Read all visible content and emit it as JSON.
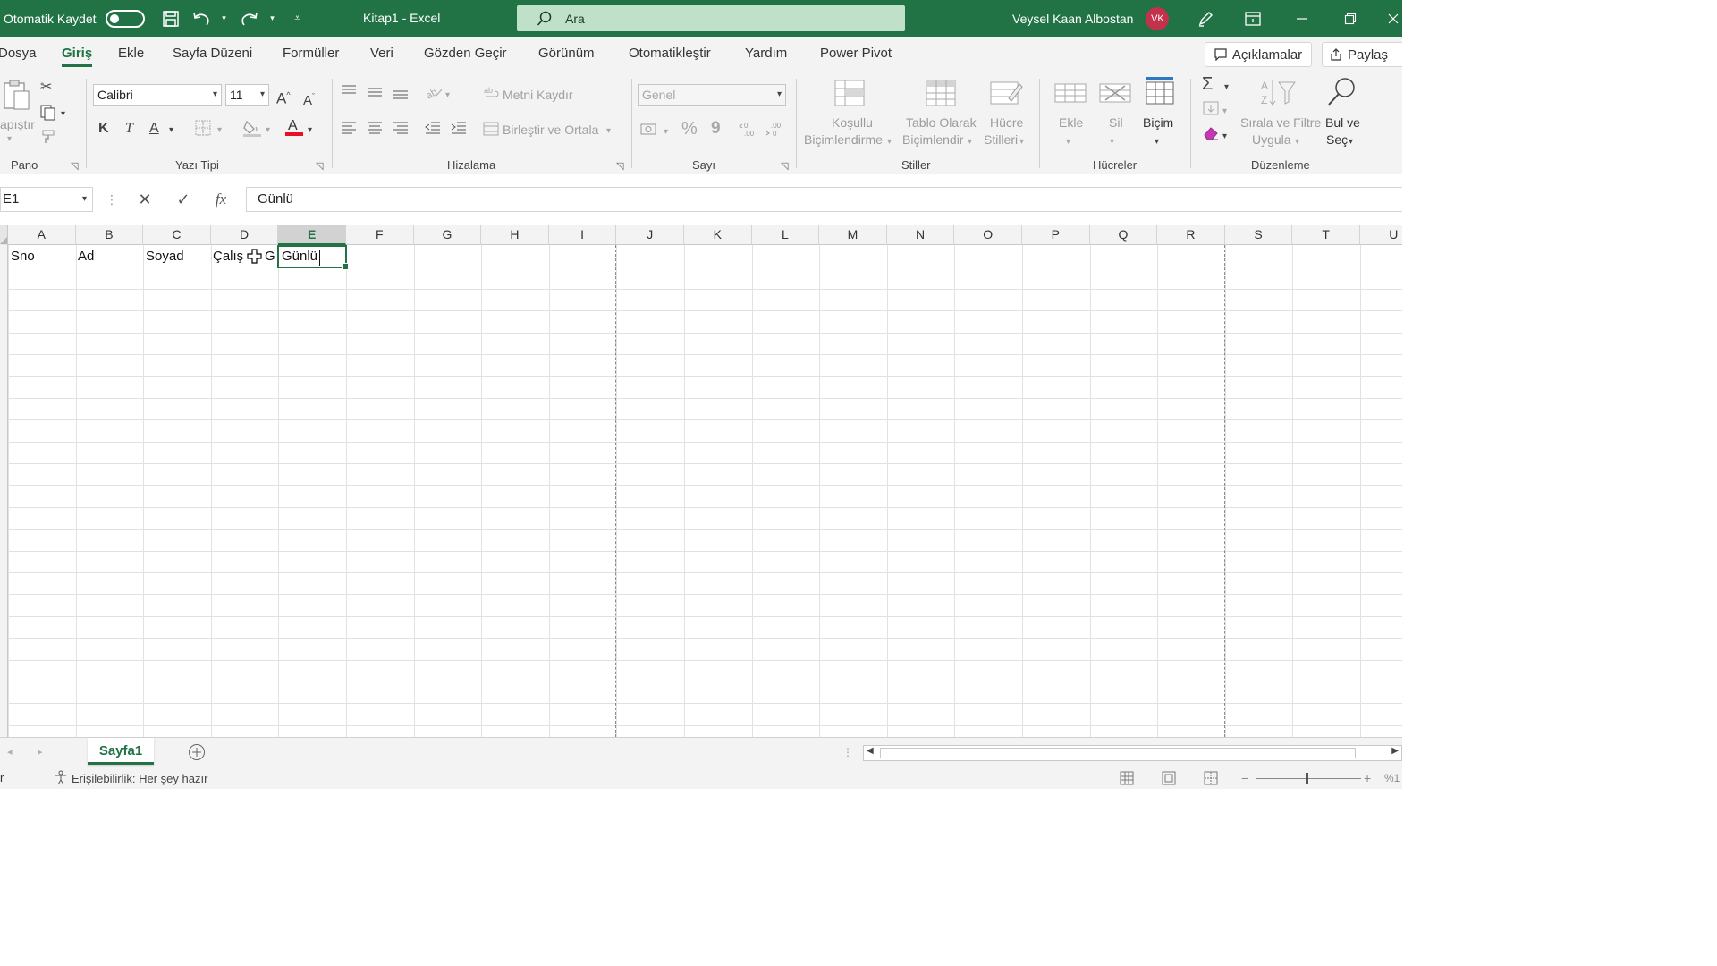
{
  "titlebar": {
    "autosave_label": "Otomatik Kaydet",
    "doc_title": "Kitap1 - Excel",
    "search_placeholder": "Ara",
    "user_name": "Veysel Kaan Albostan",
    "user_initials": "VK",
    "accent": "#217346"
  },
  "menu": {
    "tabs": [
      "Dosya",
      "Giriş",
      "Ekle",
      "Sayfa Düzeni",
      "Formüller",
      "Veri",
      "Gözden Geçir",
      "Görünüm",
      "Otomatikleştir",
      "Yardım",
      "Power Pivot"
    ],
    "active": "Giriş",
    "comments": "Açıklamalar",
    "share": "Paylaş"
  },
  "ribbon": {
    "pano": {
      "label": "Pano",
      "paste": "apıştır"
    },
    "font": {
      "label": "Yazı Tipi",
      "family": "Calibri",
      "size": "11",
      "bold": "K",
      "italic": "T",
      "underline": "A",
      "grow": "A",
      "shrink": "A"
    },
    "align": {
      "label": "Hizalama",
      "wrap": "Metni Kaydır",
      "merge": "Birleştir ve Ortala"
    },
    "number": {
      "label": "Sayı",
      "format": "Genel",
      "percent": "%",
      "comma": "9"
    },
    "styles": {
      "label": "Stiller",
      "conditional": [
        "Koşullu",
        "Biçimlendirme"
      ],
      "table": [
        "Tablo Olarak",
        "Biçimlendir"
      ],
      "cell": [
        "Hücre",
        "Stilleri"
      ]
    },
    "cells": {
      "label": "Hücreler",
      "insert": "Ekle",
      "delete": "Sil",
      "format": "Biçim"
    },
    "edit": {
      "label": "Düzenleme",
      "sort": [
        "Sırala ve Filtre",
        "Uygula"
      ],
      "find": [
        "Bul ve",
        "Seç"
      ]
    }
  },
  "formula": {
    "namebox": "E1",
    "value": "Günlü"
  },
  "grid": {
    "columns": [
      "A",
      "B",
      "C",
      "D",
      "E",
      "F",
      "G",
      "H",
      "I",
      "J",
      "K",
      "L",
      "M",
      "N",
      "O",
      "P",
      "Q",
      "R",
      "S",
      "T",
      "U"
    ],
    "selected_column": "E",
    "row1": [
      "Sno",
      "Ad",
      "Soyad",
      "Çalış",
      "Günlü"
    ],
    "d1_tail": "G"
  },
  "sheets": {
    "tabs": [
      "Sayfa1"
    ]
  },
  "status": {
    "left_fragment": "r",
    "accessibility": "Erişilebilirlik: Her şey hazır",
    "zoom_fragment": "%1"
  }
}
